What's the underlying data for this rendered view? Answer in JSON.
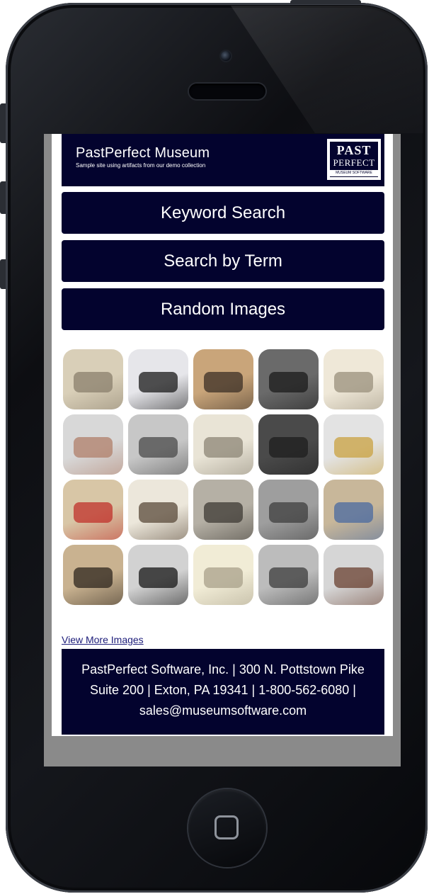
{
  "header": {
    "title": "PastPerfect Museum",
    "subtitle": "Sample site using artifacts from our demo collection",
    "logo_line1": "PAST",
    "logo_line2": "PERFECT",
    "logo_line3": "MUSEUM SOFTWARE"
  },
  "nav": {
    "keyword_search": "Keyword Search",
    "search_by_term": "Search by Term",
    "random_images": "Random Images"
  },
  "gallery": {
    "view_more": "View More Images",
    "thumbnails": [
      {
        "name": "ship-photo",
        "bg": "#d9cfb8",
        "band": "#8a7f6c"
      },
      {
        "name": "arrowhead-photo",
        "bg": "#e6e6ea",
        "band": "#1a1a1a"
      },
      {
        "name": "couple-portrait",
        "bg": "#c9a57a",
        "band": "#3b2f25"
      },
      {
        "name": "leather-bag",
        "bg": "#6a6a6a",
        "band": "#1b1b1b"
      },
      {
        "name": "handwritten-letter",
        "bg": "#efe8d8",
        "band": "#9a907c"
      },
      {
        "name": "mineral-sample",
        "bg": "#d8d8d8",
        "band": "#b07f6a"
      },
      {
        "name": "man-with-tree",
        "bg": "#c7c7c7",
        "band": "#4a4a4a"
      },
      {
        "name": "letter-page",
        "bg": "#e9e4d6",
        "band": "#8c8576"
      },
      {
        "name": "group-photo-dark",
        "bg": "#4a4a4a",
        "band": "#1e1e1e"
      },
      {
        "name": "pocket-watch",
        "bg": "#e3e3e3",
        "band": "#c9a240"
      },
      {
        "name": "toy-horse-rider",
        "bg": "#d8c6a6",
        "band": "#c0302a"
      },
      {
        "name": "open-notebook",
        "bg": "#ece7db",
        "band": "#5a4a3a"
      },
      {
        "name": "workers-photo",
        "bg": "#b5b0a5",
        "band": "#3e3a34"
      },
      {
        "name": "livestock-field",
        "bg": "#9e9e9e",
        "band": "#3d3d3d"
      },
      {
        "name": "painted-landscape",
        "bg": "#c8b79a",
        "band": "#4a6aa0"
      },
      {
        "name": "women-portrait",
        "bg": "#c9b290",
        "band": "#2e261e"
      },
      {
        "name": "rotary-telephone",
        "bg": "#d2d2d2",
        "band": "#151515"
      },
      {
        "name": "certificate-page",
        "bg": "#f1ecd6",
        "band": "#a8a08a"
      },
      {
        "name": "family-photo",
        "bg": "#bcbcbc",
        "band": "#3c3c3c"
      },
      {
        "name": "farmhouse-model",
        "bg": "#d6d6d6",
        "band": "#6a4030"
      }
    ]
  },
  "footer": {
    "text": "PastPerfect Software, Inc. | 300 N. Pottstown Pike Suite 200 | Exton, PA 19341 | 1-800-562-6080 | sales@museumsoftware.com"
  }
}
